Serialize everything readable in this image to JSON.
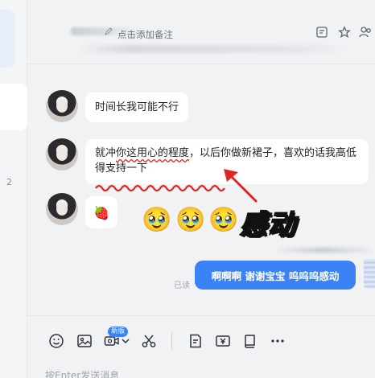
{
  "sidebar": {
    "badge_number": "2"
  },
  "header": {
    "remark_placeholder": "点击添加备注"
  },
  "messages": [
    {
      "text": "时间长我可能不行"
    },
    {
      "text_before": "就冲",
      "text_highlight": "你这用心的程度",
      "text_after": "，以后你做新裙子，喜欢的话我高低得支持一下"
    },
    {
      "sticker": "🍓"
    }
  ],
  "annotation": {
    "emojis": [
      "🥹",
      "🥹",
      "🥹"
    ],
    "caption": "感动"
  },
  "my_message": {
    "read_status": "已读",
    "text": "啊啊啊 谢谢宝宝 呜呜呜感动"
  },
  "composer": {
    "new_badge": "新版",
    "placeholder": "按Enter发送消息"
  },
  "colors": {
    "accent": "#3b82f6",
    "highlight": "#e02424",
    "caption": "#ff8fc6"
  },
  "icons": [
    "edit-icon",
    "list-icon",
    "star-icon",
    "people-icon",
    "emoji-icon",
    "image-icon",
    "video-icon",
    "scissors-icon",
    "note-icon",
    "money-icon",
    "book-icon",
    "more-icon"
  ]
}
